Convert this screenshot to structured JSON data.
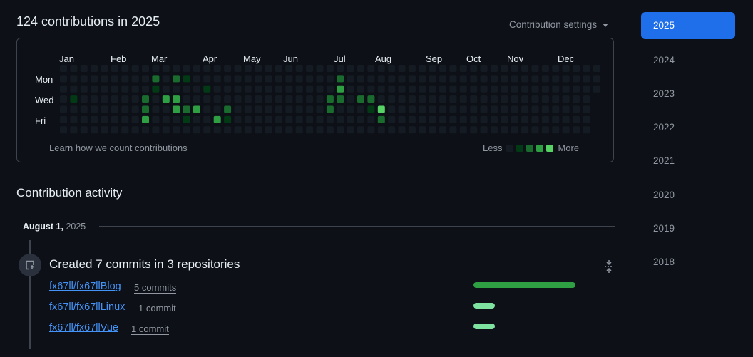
{
  "header": {
    "title": "124 contributions in 2025",
    "settings_label": "Contribution settings"
  },
  "calendar": {
    "months": [
      "Jan",
      "Feb",
      "Mar",
      "Apr",
      "May",
      "Jun",
      "Jul",
      "Aug",
      "Sep",
      "Oct",
      "Nov",
      "Dec"
    ],
    "day_labels": [
      "Mon",
      "Wed",
      "Fri"
    ],
    "learn_link": "Learn how we count contributions",
    "legend_less": "Less",
    "legend_more": "More",
    "level_colors": [
      "#151b23",
      "#033a16",
      "#196c2e",
      "#2ea043",
      "#56d364"
    ],
    "active_days": [
      {
        "week": 1,
        "day": 3,
        "level": 1
      },
      {
        "week": 8,
        "day": 3,
        "level": 2
      },
      {
        "week": 8,
        "day": 4,
        "level": 2
      },
      {
        "week": 8,
        "day": 5,
        "level": 3
      },
      {
        "week": 9,
        "day": 1,
        "level": 2
      },
      {
        "week": 9,
        "day": 2,
        "level": 1
      },
      {
        "week": 10,
        "day": 3,
        "level": 3
      },
      {
        "week": 11,
        "day": 1,
        "level": 2
      },
      {
        "week": 11,
        "day": 3,
        "level": 3
      },
      {
        "week": 11,
        "day": 4,
        "level": 3
      },
      {
        "week": 12,
        "day": 1,
        "level": 1
      },
      {
        "week": 12,
        "day": 4,
        "level": 2
      },
      {
        "week": 12,
        "day": 5,
        "level": 1
      },
      {
        "week": 13,
        "day": 4,
        "level": 3
      },
      {
        "week": 14,
        "day": 2,
        "level": 1
      },
      {
        "week": 15,
        "day": 5,
        "level": 3
      },
      {
        "week": 16,
        "day": 4,
        "level": 2
      },
      {
        "week": 16,
        "day": 5,
        "level": 1
      },
      {
        "week": 26,
        "day": 3,
        "level": 2
      },
      {
        "week": 26,
        "day": 4,
        "level": 2
      },
      {
        "week": 27,
        "day": 1,
        "level": 2
      },
      {
        "week": 27,
        "day": 2,
        "level": 3
      },
      {
        "week": 27,
        "day": 3,
        "level": 2
      },
      {
        "week": 29,
        "day": 3,
        "level": 2
      },
      {
        "week": 30,
        "day": 3,
        "level": 2
      },
      {
        "week": 30,
        "day": 4,
        "level": 1
      },
      {
        "week": 31,
        "day": 4,
        "level": 4
      },
      {
        "week": 31,
        "day": 5,
        "level": 2
      }
    ]
  },
  "activity": {
    "title": "Contribution activity",
    "date_label": "August 1,",
    "date_year": "2025",
    "summary": "Created 7 commits in 3 repositories",
    "repos": [
      {
        "name": "fx67ll/fx67llBlog",
        "count": "5 commits",
        "commits": 5
      },
      {
        "name": "fx67ll/fx67llLinux",
        "count": "1 commit",
        "commits": 1
      },
      {
        "name": "fx67ll/fx67llVue",
        "count": "1 commit",
        "commits": 1
      }
    ],
    "bar_colors": {
      "primary": "#2ea043",
      "secondary": "#7ee2a0"
    }
  },
  "years": {
    "active": "2025",
    "list": [
      "2025",
      "2024",
      "2023",
      "2022",
      "2021",
      "2020",
      "2019",
      "2018"
    ]
  }
}
